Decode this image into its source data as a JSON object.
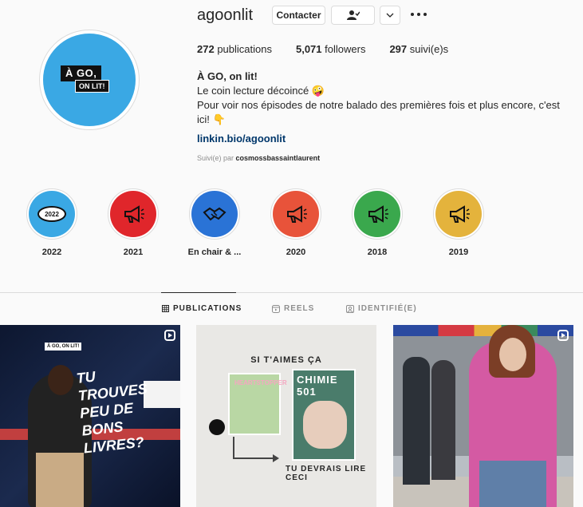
{
  "profile": {
    "username": "agoonlit",
    "avatar_text_top": "À GO,",
    "avatar_text_bottom": "ON LIT!",
    "contact_label": "Contacter"
  },
  "stats": {
    "posts_count": "272",
    "posts_label": "publications",
    "followers_count": "5,071",
    "followers_label": "followers",
    "following_count": "297",
    "following_label": "suivi(e)s"
  },
  "bio": {
    "name": "À GO, on lit!",
    "line1": "Le coin lecture décoincé 🤪",
    "line2": "Pour voir nos épisodes de notre balado des premières fois et plus encore, c'est ici! 👇",
    "link": "linkin.bio/agoonlit",
    "followed_by_prefix": "Suivi(e) par",
    "followed_by_user": "cosmossbassaintlaurent"
  },
  "highlights": [
    {
      "label": "2022",
      "badge": "2022",
      "color": "#3aa8e4"
    },
    {
      "label": "2021",
      "color": "#e0262b"
    },
    {
      "label": "En chair & ...",
      "color": "#2a73d6"
    },
    {
      "label": "2020",
      "color": "#e8533a"
    },
    {
      "label": "2018",
      "color": "#3aa84d"
    },
    {
      "label": "2019",
      "color": "#e4b33c"
    }
  ],
  "tabs": {
    "publications": "PUBLICATIONS",
    "reels": "REELS",
    "tagged": "IDENTIFIÉ(E)"
  },
  "posts": {
    "post1": {
      "logo": "À GO, ON LIT!",
      "headline": "TU TROUVES PEU DE BONS LIVRES?"
    },
    "post2": {
      "header": "SI T'AIMES ÇA",
      "book1": "HEARTSTOPPER",
      "book2": "CHIMIE 501",
      "footer": "TU DEVRAIS LIRE CECI"
    }
  },
  "colors": {
    "accent_link": "#00376b",
    "border": "#dbdbdb",
    "text": "#262626",
    "muted": "#8e8e8e"
  }
}
